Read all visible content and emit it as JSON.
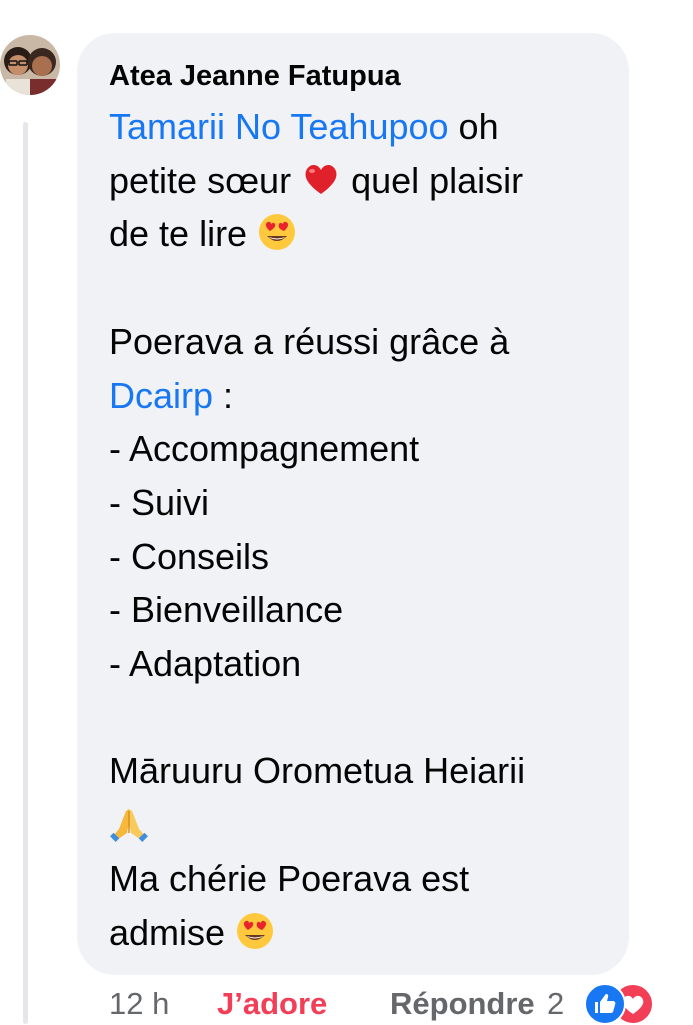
{
  "comment": {
    "author": "Atea Jeanne Fatupua",
    "lines": {
      "mention1": "Tamarii No Teahupoo",
      "l1_tail": " oh",
      "l2_head": "petite sœur ",
      "l2_tail": " quel plaisir",
      "l3_head": "de te lire ",
      "l4": "Poerava a réussi grâce à",
      "mention2": "Dcairp",
      "l5_tail": " :",
      "l6": "- Accompagnement",
      "l7": "- Suivi",
      "l8": "- Conseils",
      "l9": "- Bienveillance",
      "l10": "- Adaptation",
      "l11": "Māruuru Orometua Heiarii",
      "l13": "Ma chérie Poerava est",
      "l14_head": "admise "
    },
    "emojis": {
      "heart": "red-heart-emoji",
      "heart_eyes": "heart-eyes-emoji",
      "pray": "folded-hands-emoji"
    }
  },
  "footer": {
    "time": "12 h",
    "love_label": "J’adore",
    "reply_label": "Répondre",
    "reaction_count": "2",
    "reactions": [
      "like-icon",
      "love-icon"
    ]
  },
  "colors": {
    "bubble": "#f0f2f5",
    "mention": "#1877f2",
    "love": "#f33e58",
    "meta": "#65676b"
  }
}
